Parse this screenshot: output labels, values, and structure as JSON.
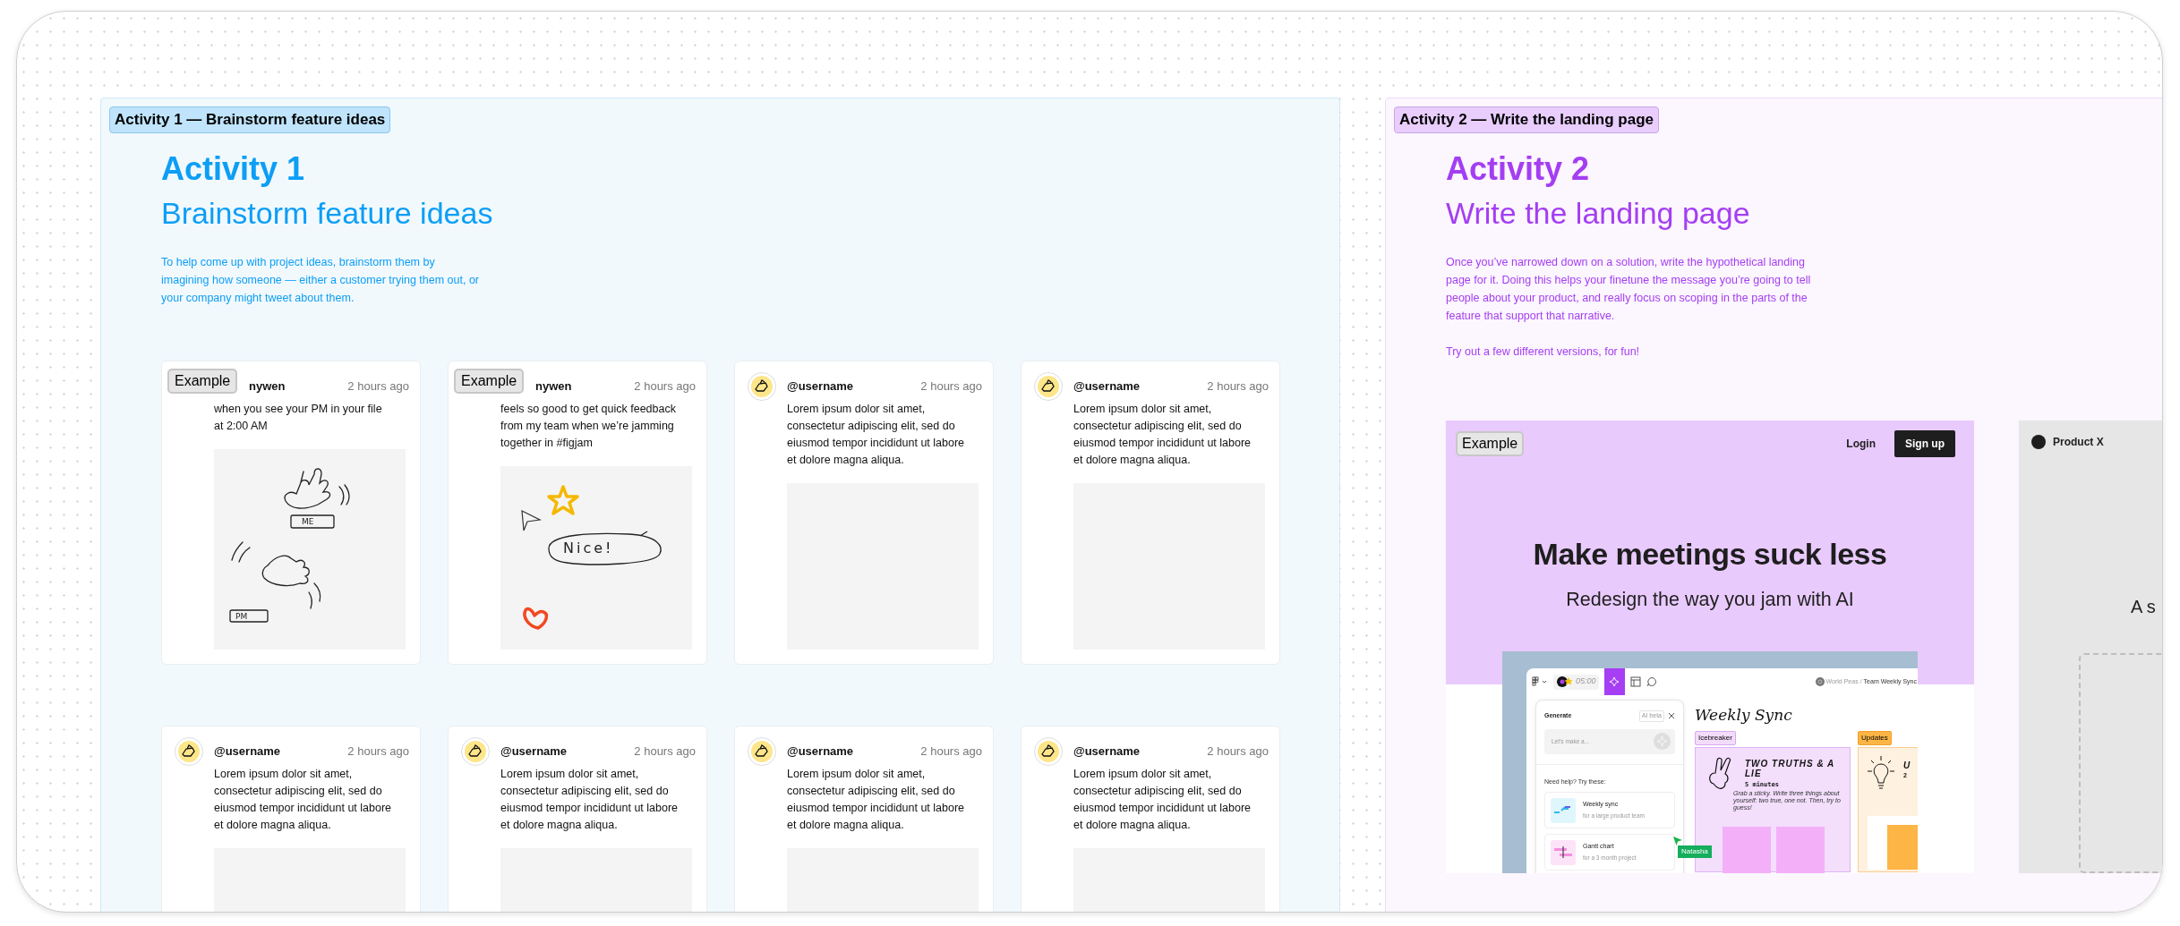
{
  "sections": [
    {
      "kind": "brainstorm",
      "label": "Activity 1 — Brainstorm feature ideas",
      "title": "Activity 1",
      "subtitle": "Brainstorm feature ideas",
      "paragraphs": [
        "To help come up with project ideas, brainstorm them by imagining how someone — either a customer trying them out, or your company might tweet about them."
      ],
      "posts": [
        {
          "badge": "Example",
          "username": "nywen",
          "time": "2 hours ago",
          "text": "when you see your PM in your file at 2:00 AM",
          "sketch": {
            "kind": "hands",
            "words": [
              "ME",
              "PM"
            ]
          }
        },
        {
          "badge": "Example",
          "username": "nywen",
          "time": "2 hours ago",
          "text": "feels so good to get quick feedback from my team when we’re jamming together in #figjam",
          "sketch": {
            "kind": "reactions",
            "words": [
              "Nice!"
            ]
          }
        },
        {
          "username": "@username",
          "time": "2 hours ago",
          "text": "Lorem ipsum dolor sit amet, consectetur adipiscing elit, sed do eiusmod tempor incididunt ut labore et dolore magna aliqua."
        },
        {
          "username": "@username",
          "time": "2 hours ago",
          "text": "Lorem ipsum dolor sit amet, consectetur adipiscing elit, sed do eiusmod tempor incididunt ut labore et dolore magna aliqua."
        },
        {
          "username": "@username",
          "time": "2 hours ago",
          "text": "Lorem ipsum dolor sit amet, consectetur adipiscing elit, sed do eiusmod tempor incididunt ut labore et dolore magna aliqua."
        },
        {
          "username": "@username",
          "time": "2 hours ago",
          "text": "Lorem ipsum dolor sit amet, consectetur adipiscing elit, sed do eiusmod tempor incididunt ut labore et dolore magna aliqua."
        },
        {
          "username": "@username",
          "time": "2 hours ago",
          "text": "Lorem ipsum dolor sit amet, consectetur adipiscing elit, sed do eiusmod tempor incididunt ut labore et dolore magna aliqua."
        },
        {
          "username": "@username",
          "time": "2 hours ago",
          "text": "Lorem ipsum dolor sit amet, consectetur adipiscing elit, sed do eiusmod tempor incididunt ut labore et dolore magna aliqua."
        }
      ]
    },
    {
      "kind": "landing",
      "label": "Activity 2 — Write the landing page",
      "title": "Activity 2",
      "subtitle": "Write the landing page",
      "paragraphs": [
        "Once you’ve narrowed down on a solution, write the hypothetical landing page for it. Doing this helps your finetune the message you’re going to tell people about your product, and really focus on scoping in the parts of the feature that support that narrative.",
        "Try out a few different versions, for fun!"
      ],
      "landing_pages": [
        {
          "kind": "hero",
          "badge": "Example",
          "nav": [
            "Login",
            "Sign up"
          ],
          "headline": "Make meetings suck less",
          "subheadline": "Redesign the way you jam with AI",
          "app": {
            "timer": "05:00",
            "breadcrumb": [
              "World Peas",
              "/",
              "Team Weekly Sync"
            ],
            "panel": {
              "title": "Generate",
              "tag": "AI beta",
              "placeholder": "Let’s make a...",
              "hint": "Need help? Try these:",
              "templates": [
                {
                  "kind": "sync",
                  "name": "Weekly sync",
                  "description": "for a large product team"
                },
                {
                  "kind": "gantt",
                  "name": "Gantt chart",
                  "description": "for a 3 month project"
                }
              ]
            },
            "board": {
              "title": "Weekly Sync",
              "columns": [
                {
                  "kind": "icebreaker",
                  "tag": "Icebreaker",
                  "card_title": "TWO TRUTHS & A LIE",
                  "duration": "5 minutes",
                  "instructions": "Grab a sticky. Write three things about yourself: two true, one not. Then, try to guess!"
                },
                {
                  "kind": "updates",
                  "tag": "Updates",
                  "card_title": "U",
                  "duration": "2"
                }
              ]
            },
            "cursor": {
              "name": "Natasha"
            }
          }
        },
        {
          "kind": "draft",
          "brand": "Product X",
          "headline": "A s"
        }
      ]
    }
  ]
}
